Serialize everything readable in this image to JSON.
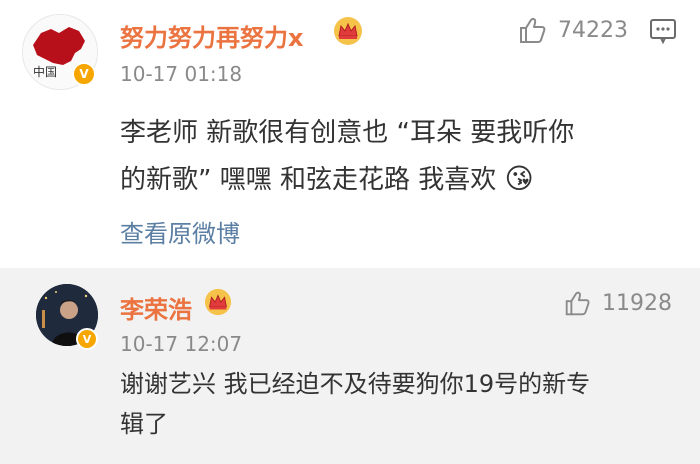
{
  "comment": {
    "username": "努力努力再努力x",
    "avatar_text": "中国",
    "timestamp": "10-17 01:18",
    "like_count": "74223",
    "text_line1": "李老师 新歌很有创意也 “耳朵 要我听你",
    "text_line2": "的新歌” 嘿嘿 和弦走花路 我喜欢",
    "emoji": "😘",
    "view_original": "查看原微博",
    "verified_badge": "V"
  },
  "reply": {
    "username": "李荣浩",
    "timestamp": "10-17 12:07",
    "like_count": "11928",
    "text_line1": "谢谢艺兴 我已经迫不及待要狗你19号的新专",
    "text_line2": "辑了",
    "verified_badge": "V"
  },
  "icons": {
    "like": "thumbs-up-icon",
    "reply": "comment-icon",
    "crown": "crown-icon"
  },
  "colors": {
    "username": "#eb7340",
    "meta_gray": "#8a8a8a",
    "link_blue": "#5b7ea3",
    "reply_bg": "#f2f2f2"
  }
}
